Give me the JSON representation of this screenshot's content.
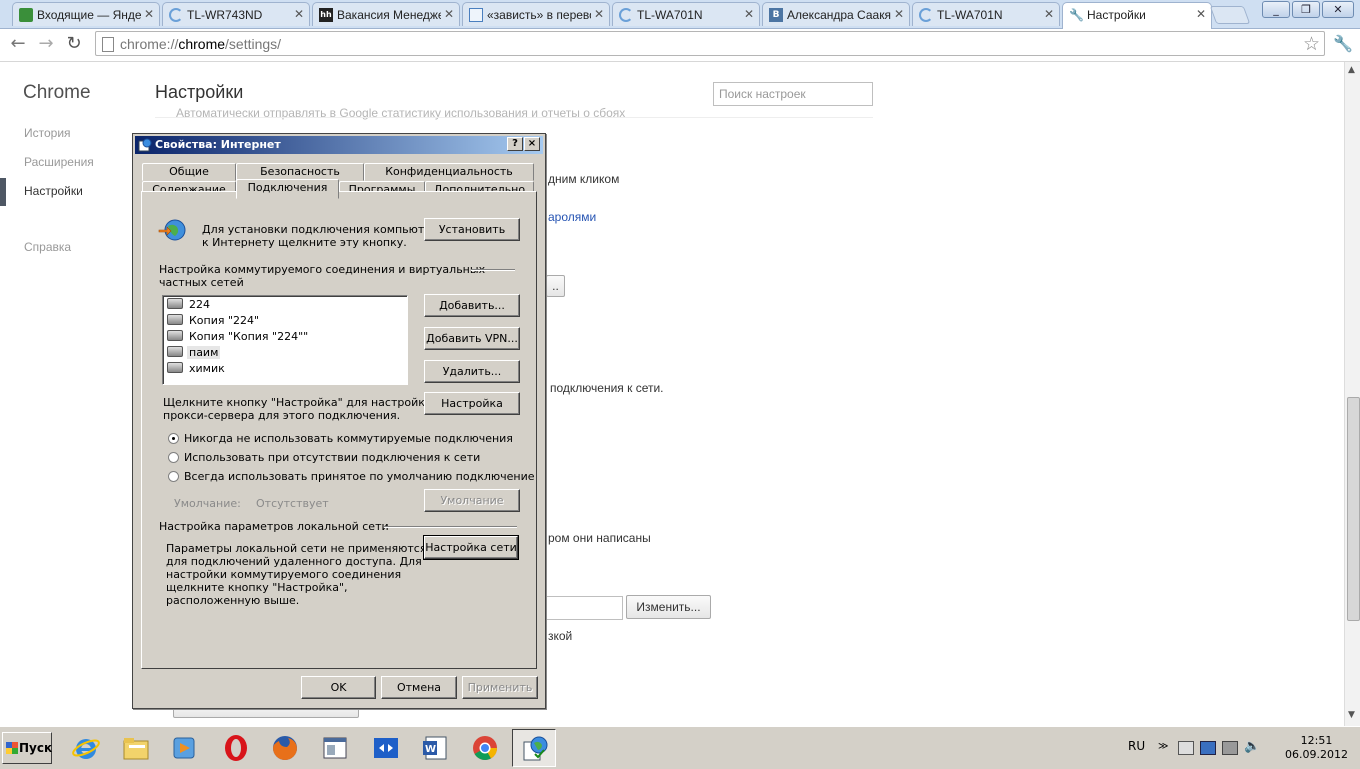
{
  "tabs": [
    {
      "title": "Входящие — Яндекс",
      "icon": "mail-icon",
      "color": "#3a8f3a"
    },
    {
      "title": "TL-WR743ND",
      "icon": "loading-icon",
      "color": "#6aa0d8"
    },
    {
      "title": "Вакансия Менеджер",
      "icon": "hh-icon",
      "color": "#222"
    },
    {
      "title": "«зависть» в перевод",
      "icon": "document-icon",
      "color": "#4a7fbf"
    },
    {
      "title": "TL-WA701N",
      "icon": "loading-icon",
      "color": "#6aa0d8"
    },
    {
      "title": "Александра Саакян",
      "icon": "vk-icon",
      "color": "#4c75a3"
    },
    {
      "title": "TL-WA701N",
      "icon": "loading-icon",
      "color": "#6aa0d8"
    },
    {
      "title": "Настройки",
      "icon": "wrench-icon",
      "color": "#555"
    }
  ],
  "toolbar": {
    "url_prefix": "chrome://",
    "url_host": "chrome",
    "url_path": "/settings/"
  },
  "sidebar": {
    "title": "Chrome",
    "items": [
      "История",
      "Расширения",
      "Настройки",
      "Справка"
    ]
  },
  "settings": {
    "title": "Настройки",
    "search_placeholder": "Поиск настроек",
    "faded_line": "Автоматически отправлять в Google статистику использования и отчеты о сбоях",
    "frag1": "дним кликом",
    "frag2": "аролями",
    "frag3": "подключения к сети.",
    "frag4": "ром они написаны",
    "frag5": "зкой",
    "change_button": "Изменить...",
    "partial_button": ".."
  },
  "dialog": {
    "title": "Свойства: Интернет",
    "help_btn": "?",
    "close_btn": "×",
    "tabs_row1": [
      "Общие",
      "Безопасность",
      "Конфиденциальность"
    ],
    "tabs_row2": [
      "Содержание",
      "Подключения",
      "Программы",
      "Дополнительно"
    ],
    "setup_text_1": "Для установки подключения компьютера",
    "setup_text_2": "к Интернету щелкните эту кнопку.",
    "setup_button": "Установить",
    "dialup_header_1": "Настройка коммутируемого соединения и виртуальных",
    "dialup_header_2": "частных сетей",
    "connections": [
      "224",
      "Копия \"224\"",
      "Копия \"Копия \"224\"\"",
      "паим",
      "химик"
    ],
    "selected_connection": "паим",
    "add_button": "Добавить...",
    "add_vpn_button": "Добавить VPN...",
    "delete_button": "Удалить...",
    "proxy_text_1": "Щелкните кнопку \"Настройка\" для настройки",
    "proxy_text_2": "прокси-сервера для этого подключения.",
    "settings_button": "Настройка",
    "radio_options": [
      "Никогда не использовать коммутируемые подключения",
      "Использовать при отсутствии подключения к сети",
      "Всегда использовать принятое по умолчанию подключение"
    ],
    "radio_selected": 0,
    "default_label": "Умолчание:",
    "default_value": "Отсутствует",
    "default_button": "Умолчание",
    "lan_header": "Настройка параметров локальной сети",
    "lan_text": [
      "Параметры локальной сети не применяются",
      "для подключений удаленного доступа. Для",
      "настройки коммутируемого соединения",
      "щелкните кнопку \"Настройка\",",
      "расположенную выше."
    ],
    "lan_button": "Настройка сети",
    "ok_button": "OK",
    "cancel_button": "Отмена",
    "apply_button": "Применить"
  },
  "taskbar": {
    "start_label": "Пуск",
    "apps": [
      "ie-icon",
      "explorer-icon",
      "media-player-icon",
      "opera-icon",
      "firefox-icon",
      "window-icon",
      "network-switch-icon",
      "word-icon",
      "chrome-icon",
      "internet-options-icon"
    ],
    "language": "RU",
    "time": "12:51",
    "date": "06.09.2012"
  }
}
